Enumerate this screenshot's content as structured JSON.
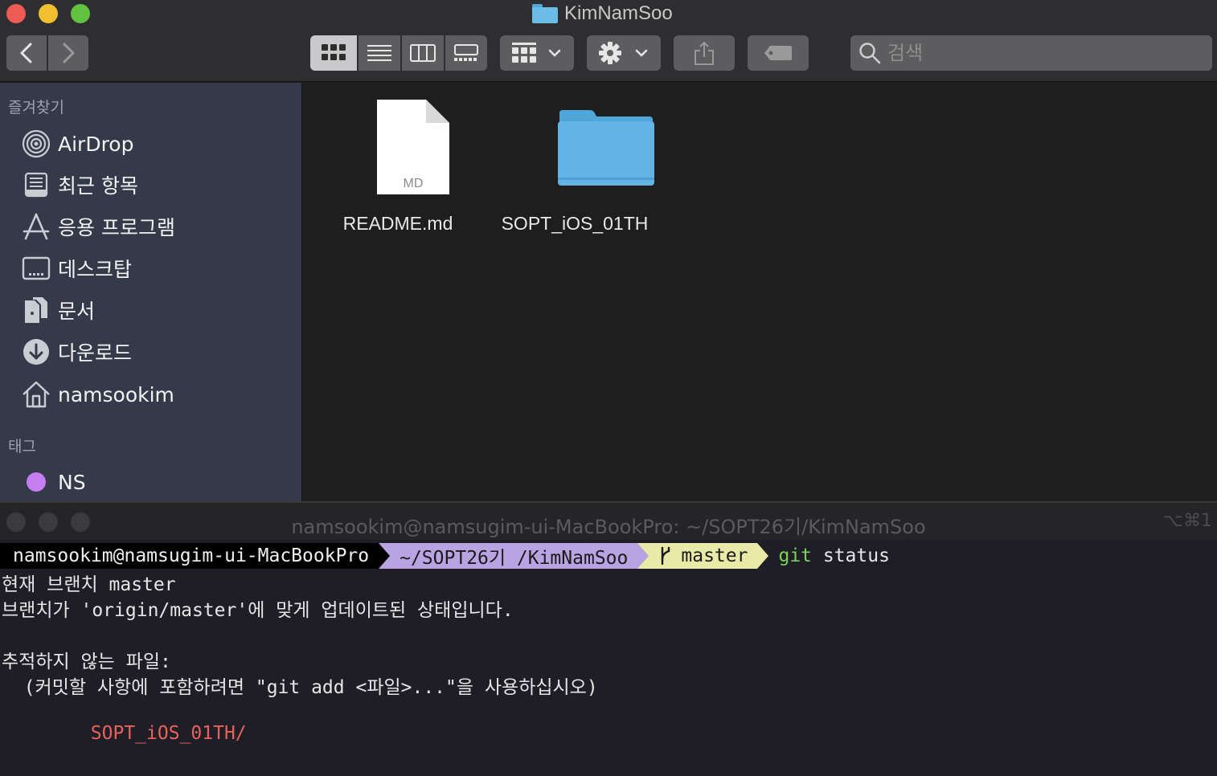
{
  "finder": {
    "title": "KimNamSoo",
    "search_placeholder": "검색",
    "sidebar": {
      "favorites_header": "즐겨찾기",
      "items": [
        {
          "label": "AirDrop",
          "icon": "airdrop-icon"
        },
        {
          "label": "최근 항목",
          "icon": "recents-icon"
        },
        {
          "label": "응용 프로그램",
          "icon": "applications-icon"
        },
        {
          "label": "데스크탑",
          "icon": "desktop-icon"
        },
        {
          "label": "문서",
          "icon": "documents-icon"
        },
        {
          "label": "다운로드",
          "icon": "downloads-icon"
        },
        {
          "label": "namsookim",
          "icon": "home-icon"
        }
      ],
      "tags_header": "태그",
      "tags": [
        {
          "label": "NS",
          "color": "#c57ef0"
        }
      ]
    },
    "files": [
      {
        "name": "README.md",
        "badge": "MD",
        "type": "document"
      },
      {
        "name": "SOPT_iOS_01TH",
        "type": "folder"
      }
    ]
  },
  "terminal": {
    "title": "namsookim@namsugim-ui-MacBookPro: ~/SOPT26기/KimNamSoo",
    "shortcut": "⌥⌘1",
    "prompt": {
      "user": "namsookim@namsugim-ui-MacBookPro",
      "path": "~/SOPT26기 /KimNamSoo",
      "branch": "master",
      "command_git": "git",
      "command_rest": " status"
    },
    "lines": [
      "현재 브랜치 master",
      "브랜치가 'origin/master'에 맞게 업데이트된 상태입니다.",
      "",
      "추적하지 않는 파일:",
      "  (커밋할 사항에 포함하려면 \"git add <파일>...\"을 사용하십시오)",
      "",
      "        SOPT_iOS_01TH/"
    ]
  }
}
